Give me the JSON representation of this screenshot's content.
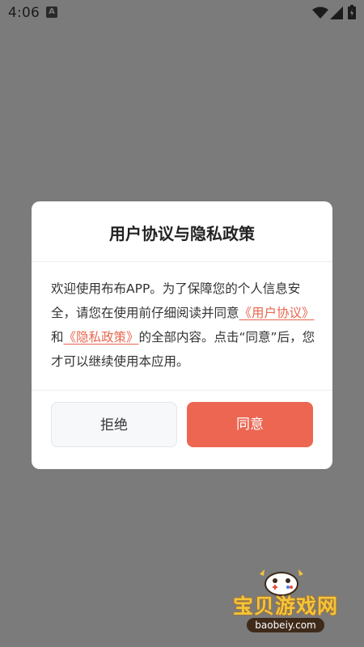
{
  "status_bar": {
    "time": "4:06",
    "notification_glyph": "A",
    "icons": [
      "wifi-icon",
      "signal-icon",
      "battery-icon"
    ]
  },
  "dialog": {
    "title": "用户协议与隐私政策",
    "body": {
      "part1": "欢迎使用布布APP。为了保障您的个人信息安全，请您在使用前仔细阅读并同意",
      "link_user_agreement": "《用户协议》",
      "conjunction": "和",
      "link_privacy_policy": "《隐私政策》",
      "part2": "的全部内容。点击“同意”后，您才可以继续使用本应用。"
    },
    "reject_label": "拒绝",
    "agree_label": "同意"
  },
  "watermark": {
    "title": "宝贝游戏网",
    "url": "baobeiy.com"
  },
  "colors": {
    "overlay": "#7b7b7b",
    "accent": "#ec6652",
    "link": "#e8664f",
    "reject_bg": "#f7f8fa",
    "text": "#333333"
  }
}
